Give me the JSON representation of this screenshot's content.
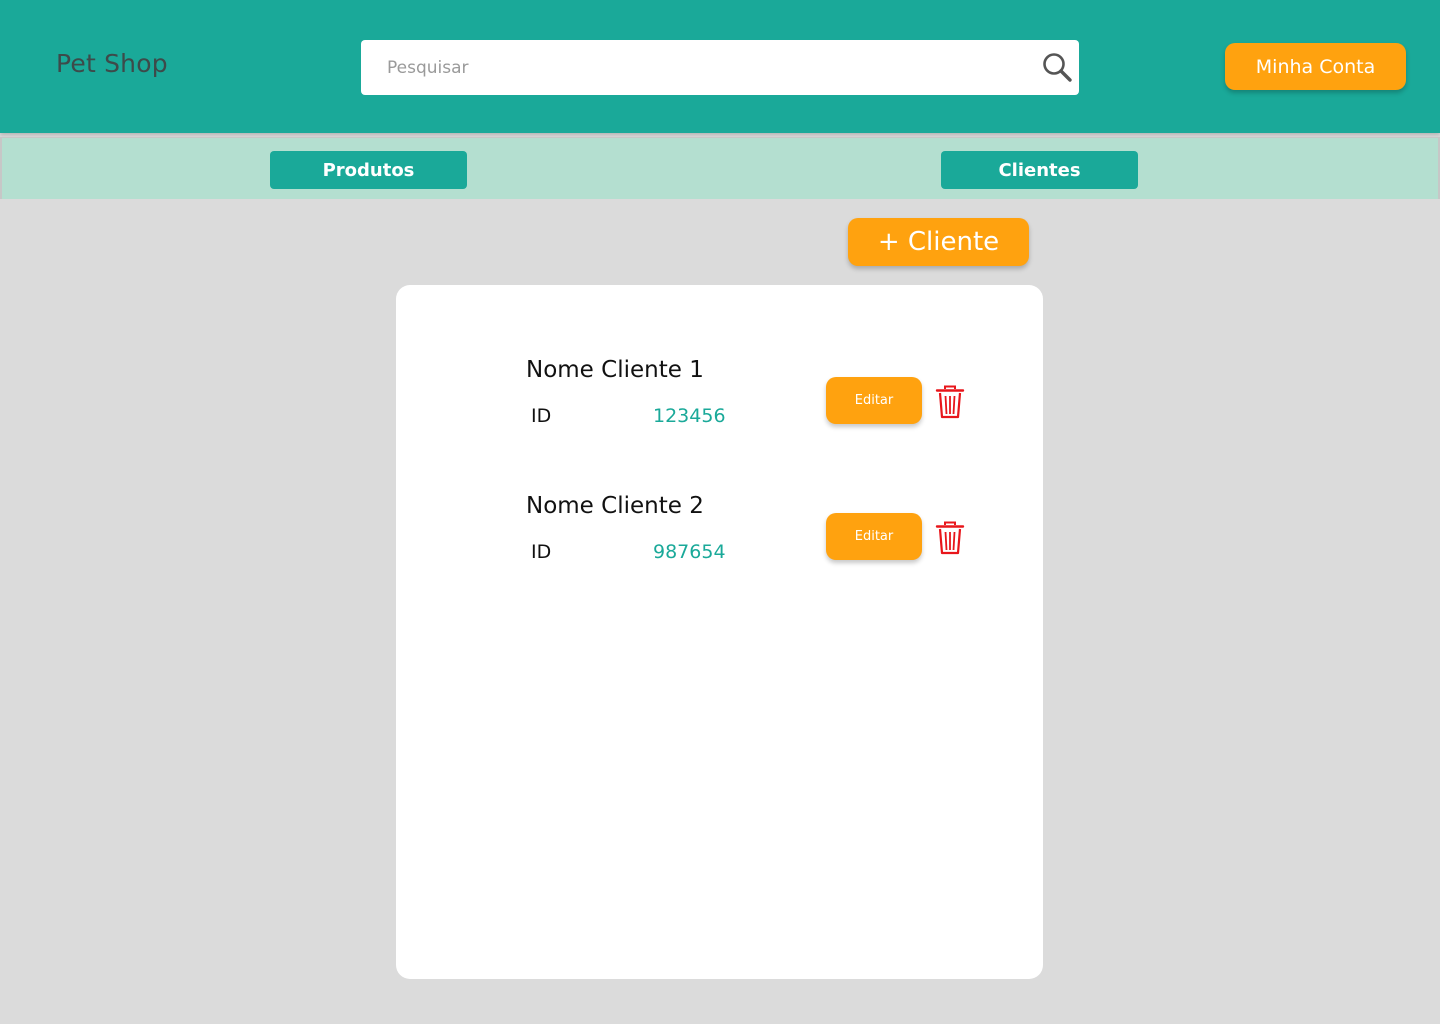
{
  "header": {
    "logo": "Pet Shop",
    "search": {
      "placeholder": "Pesquisar",
      "icon": "search-icon"
    },
    "account_button": "Minha Conta"
  },
  "nav": {
    "tabs": [
      {
        "label": "Produtos"
      },
      {
        "label": "Clientes"
      }
    ]
  },
  "main": {
    "add_button": "+ Cliente",
    "clients": [
      {
        "name": "Nome Cliente 1",
        "id_label": "ID",
        "id_value": "123456",
        "edit_label": "Editar",
        "delete_icon": "trash-icon"
      },
      {
        "name": "Nome Cliente 2",
        "id_label": "ID",
        "id_value": "987654",
        "edit_label": "Editar",
        "delete_icon": "trash-icon"
      }
    ]
  },
  "colors": {
    "primary": "#1aa999",
    "accent": "#ffa20f",
    "nav_bg": "#b4dfd0",
    "page_bg": "#dbdbdb",
    "danger": "#e8161b"
  }
}
